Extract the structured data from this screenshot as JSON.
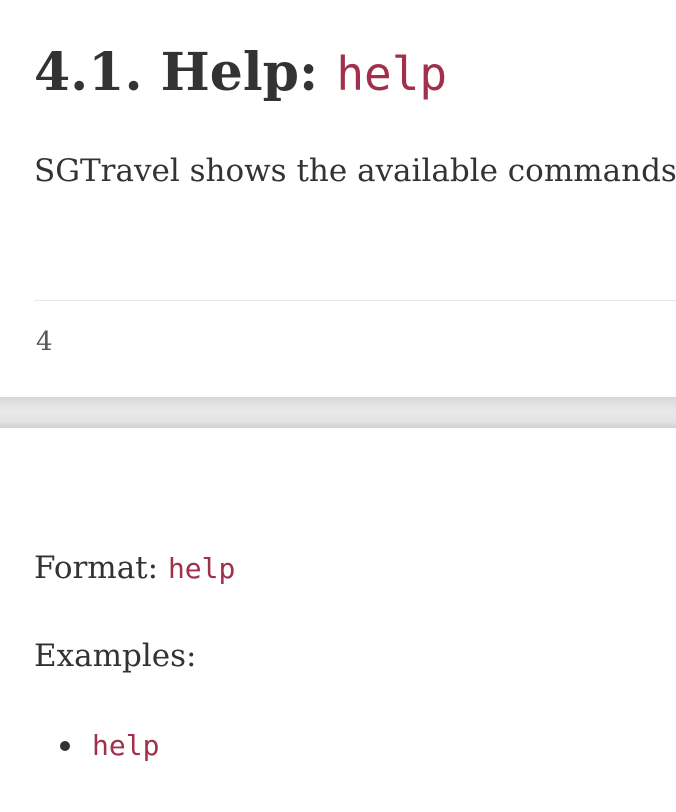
{
  "section": {
    "heading_text": "4.1. Help: ",
    "heading_code": "help",
    "intro": "SGTravel shows the available commands"
  },
  "footer": {
    "page_number": "4"
  },
  "format": {
    "label": "Format: ",
    "code": "help"
  },
  "examples": {
    "label": "Examples:",
    "items": [
      "help"
    ]
  }
}
